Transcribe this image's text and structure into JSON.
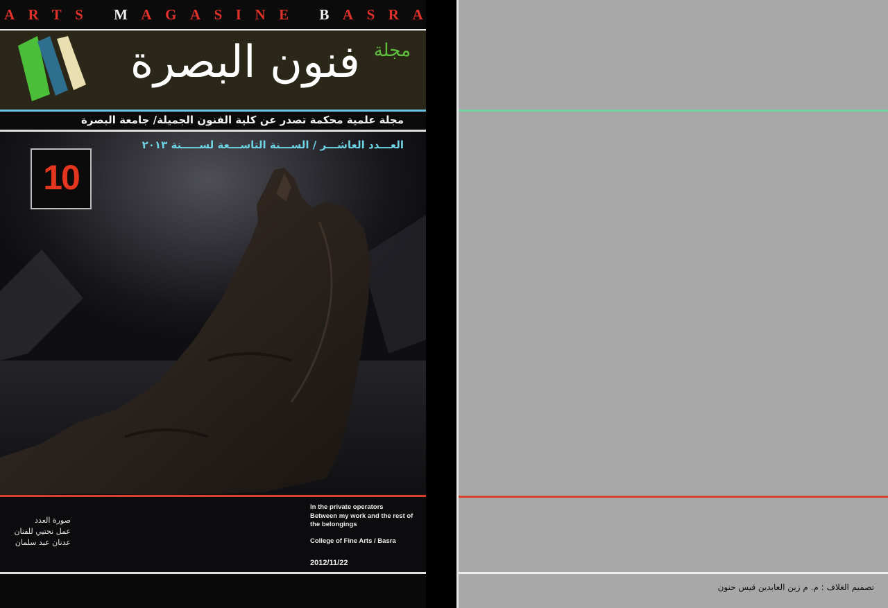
{
  "front_cover": {
    "masthead": {
      "letters": [
        "A",
        "R",
        "T",
        "S",
        " ",
        "M",
        "A",
        "G",
        "A",
        "S",
        "I",
        "N",
        "E",
        " ",
        "B",
        "A",
        "S",
        "R",
        "A"
      ],
      "highlight_letters_indexes_note": "first letter of each word shown in white",
      "highlight_indexes": [
        5,
        14
      ],
      "colors": {
        "letters": "#e0312b",
        "highlight": "#f2f2f2"
      }
    },
    "title_ar": "فنون البصرة",
    "magazine_ar": "مجلة",
    "subtitle_ar": "مجلة علمية محكمة تصدر عن كلية الفنون الجميلة/ جامعة البصرة",
    "issue_line_ar": "العـــدد العاشـــر / الســـنة التاســـعة لســـــنة ٢٠١٣",
    "issue_number": "10",
    "caption_ar": [
      "صورة العدد",
      "عمل نحتيي للفنان",
      "عدنان عبد سلمان"
    ],
    "caption_en": [
      "In the private operators",
      "Between my work and the rest of the belongings",
      "",
      "College of Fine Arts / Basra"
    ],
    "date": "2012/11/22",
    "colors": {
      "title_band": "#2b2718",
      "blue_rule": "#6fc1e0",
      "issue_text": "#6ed3e3",
      "issue_number": "#e4351f",
      "red_rule": "#d6402d",
      "logo_green": "#4bbf3a",
      "logo_blue": "#2e6e8e",
      "logo_cream": "#e9dfb0"
    }
  },
  "back_cover": {
    "credit_ar": "تصميم الغلاف : م. م زين العابدين قيس حنون",
    "colors": {
      "background": "#a8a8a8",
      "green_rule": "#72d19f",
      "red_rule": "#d6402d"
    }
  }
}
